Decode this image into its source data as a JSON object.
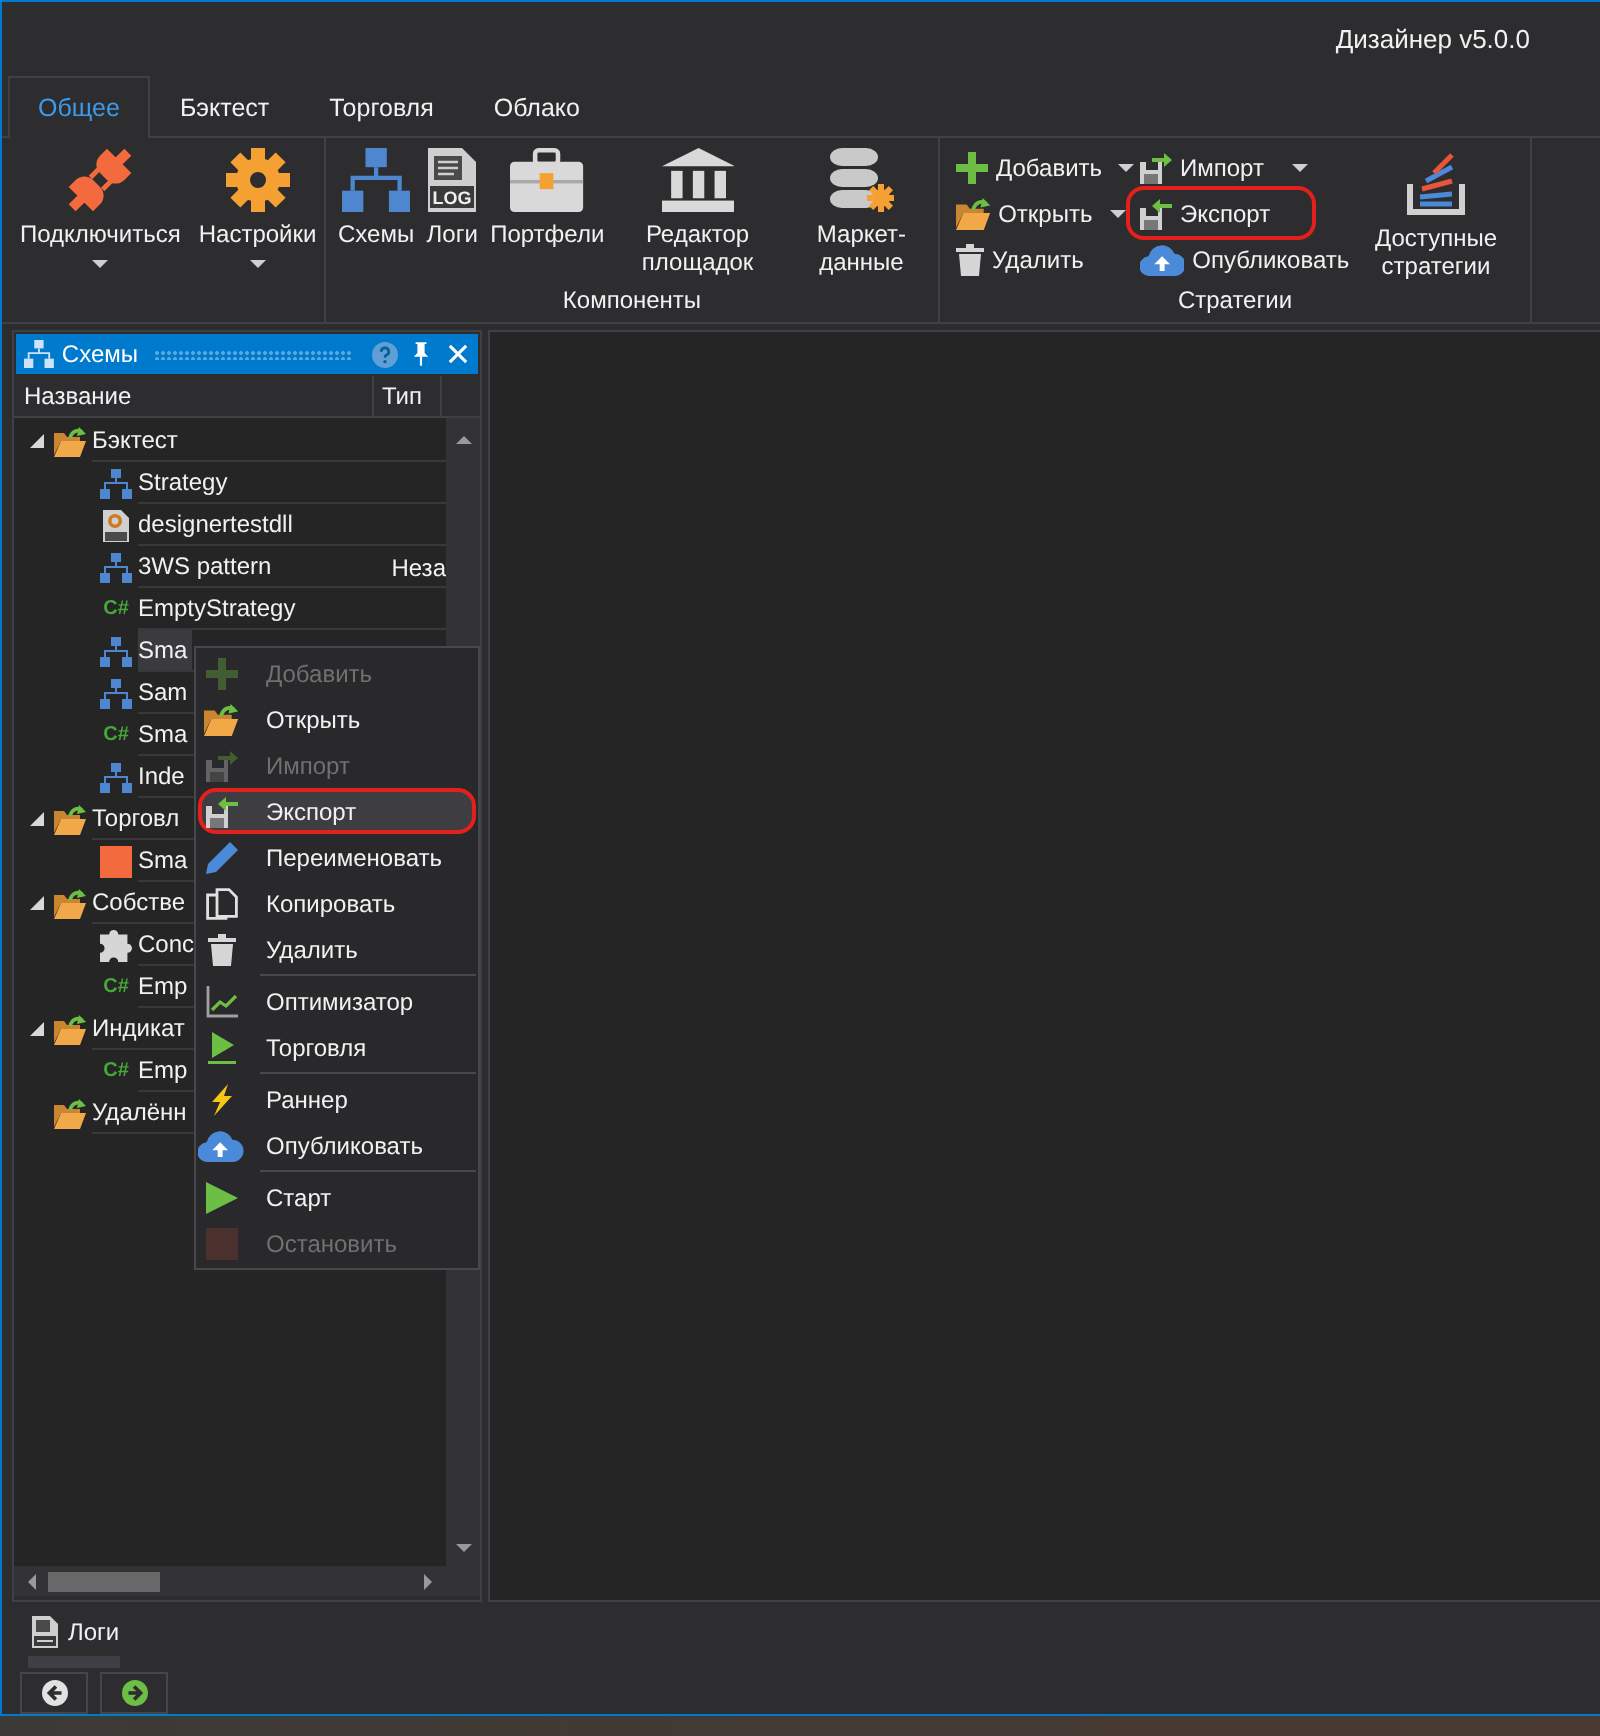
{
  "window": {
    "title": "Дизайнер v5.0.0"
  },
  "tabs": [
    {
      "label": "Общее",
      "selected": true
    },
    {
      "label": "Бэктест",
      "selected": false
    },
    {
      "label": "Торговля",
      "selected": false
    },
    {
      "label": "Облако",
      "selected": false
    }
  ],
  "ribbon": {
    "groups": [
      {
        "items": [
          {
            "kind": "large",
            "label": "Подключиться",
            "dropdown": true
          },
          {
            "kind": "large",
            "label": "Настройки",
            "dropdown": true
          }
        ]
      },
      {
        "label": "Компоненты",
        "items": [
          {
            "kind": "large",
            "label": "Схемы",
            "dropdown": false
          },
          {
            "kind": "large",
            "label": "Логи",
            "icon_text": "LOG",
            "dropdown": false
          },
          {
            "kind": "large",
            "label": "Портфели",
            "dropdown": false
          },
          {
            "kind": "large",
            "label": "Редактор площадок",
            "dropdown": false
          },
          {
            "kind": "large",
            "label": "Маркет-данные",
            "dropdown": false
          }
        ]
      },
      {
        "label": "Стратегии",
        "items": [
          {
            "kind": "stack",
            "items": [
              {
                "label": "Добавить",
                "dropdown": true,
                "circled": false
              },
              {
                "label": "Открыть",
                "dropdown": true,
                "circled": false
              },
              {
                "label": "Удалить",
                "dropdown": false,
                "circled": false
              }
            ]
          },
          {
            "kind": "stack",
            "items": [
              {
                "label": "Импорт",
                "dropdown": true,
                "circled": false
              },
              {
                "label": "Экспорт",
                "dropdown": false,
                "circled": true
              },
              {
                "label": "Опубликовать",
                "dropdown": false,
                "circled": false
              }
            ]
          },
          {
            "kind": "large",
            "label": "Доступные стратегии",
            "dropdown": false
          }
        ]
      }
    ]
  },
  "panel": {
    "title": "Схемы",
    "columns": [
      "Название",
      "Тип"
    ],
    "tree": [
      {
        "kind": "folder",
        "name": "Бэктест",
        "expanded": true,
        "selected": false,
        "children": [
          {
            "kind": "scheme",
            "name": "Strategy",
            "selected": false
          },
          {
            "kind": "dll",
            "name": "designertestdll",
            "selected": false
          },
          {
            "kind": "scheme",
            "name": "3WS pattern",
            "type": "Неза",
            "selected": false
          },
          {
            "kind": "code",
            "icon_text": "C#",
            "name": "EmptyStrategy",
            "selected": false
          },
          {
            "kind": "scheme",
            "name": "Sma",
            "selected": true
          },
          {
            "kind": "scheme",
            "name": "Sam",
            "selected": false
          },
          {
            "kind": "code",
            "icon_text": "C#",
            "name": "Sma",
            "selected": false
          },
          {
            "kind": "scheme",
            "name": "Inde",
            "selected": false
          }
        ]
      },
      {
        "kind": "folder",
        "name": "Торговл",
        "expanded": true,
        "selected": false,
        "children": [
          {
            "kind": "block",
            "name": "Sma",
            "selected": false
          }
        ]
      },
      {
        "kind": "folder",
        "name": "Собстве",
        "expanded": true,
        "selected": false,
        "children": [
          {
            "kind": "composite",
            "name": "Conc",
            "selected": false
          },
          {
            "kind": "code",
            "icon_text": "C#",
            "name": "Emp",
            "selected": false
          }
        ]
      },
      {
        "kind": "folder",
        "name": "Индикат",
        "expanded": true,
        "selected": false,
        "children": [
          {
            "kind": "code",
            "icon_text": "C#",
            "name": "Emp",
            "selected": false
          }
        ]
      },
      {
        "kind": "folder",
        "name": "Удалённ",
        "selected": false
      }
    ]
  },
  "context_menu": {
    "groups": [
      {
        "items": [
          {
            "label": "Добавить",
            "disabled": true,
            "hovered": false,
            "circled": false
          },
          {
            "label": "Открыть",
            "disabled": false,
            "hovered": false,
            "circled": false
          },
          {
            "label": "Импорт",
            "disabled": true,
            "hovered": false,
            "circled": false
          },
          {
            "label": "Экспорт",
            "disabled": false,
            "hovered": true,
            "circled": true
          },
          {
            "label": "Переименовать",
            "disabled": false,
            "hovered": false,
            "circled": false
          },
          {
            "label": "Копировать",
            "disabled": false,
            "hovered": false,
            "circled": false
          },
          {
            "label": "Удалить",
            "disabled": false,
            "hovered": false,
            "circled": false
          }
        ]
      },
      {
        "items": [
          {
            "label": "Оптимизатор",
            "disabled": false,
            "hovered": false,
            "circled": false
          },
          {
            "label": "Торговля",
            "disabled": false,
            "hovered": false,
            "circled": false
          }
        ]
      },
      {
        "items": [
          {
            "label": "Раннер",
            "disabled": false,
            "hovered": false,
            "circled": false
          },
          {
            "label": "Опубликовать",
            "disabled": false,
            "hovered": false,
            "circled": false
          }
        ]
      },
      {
        "items": [
          {
            "label": "Старт",
            "disabled": false,
            "hovered": false,
            "circled": false
          },
          {
            "label": "Остановить",
            "disabled": true,
            "hovered": false,
            "circled": false
          }
        ]
      }
    ]
  },
  "bottom_dock": {
    "tab": "Логи"
  }
}
